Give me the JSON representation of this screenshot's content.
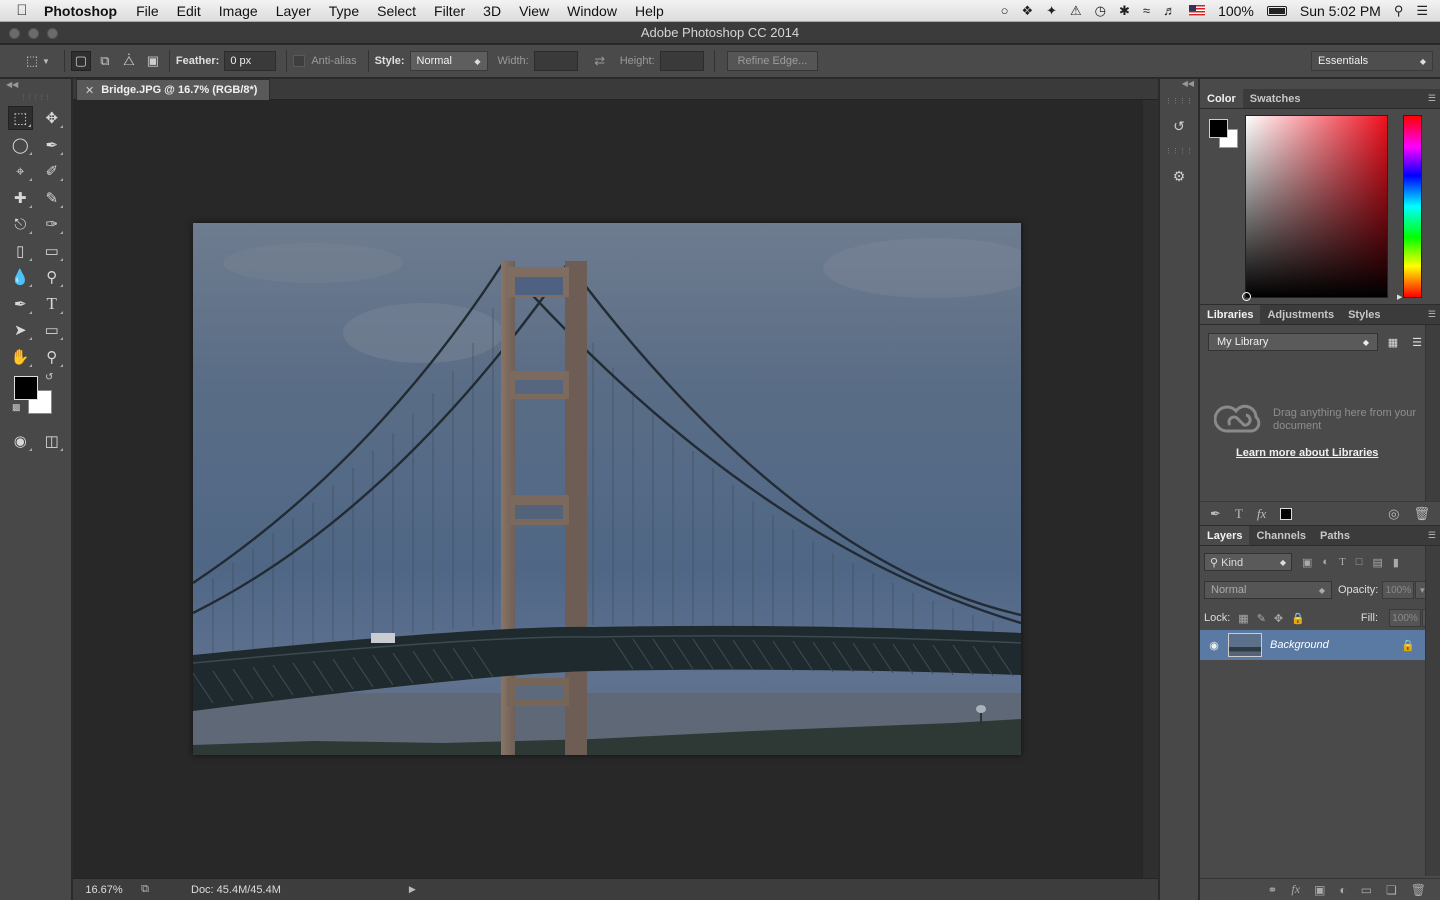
{
  "menubar": {
    "app_name": "Photoshop",
    "items": [
      "File",
      "Edit",
      "Image",
      "Layer",
      "Type",
      "Select",
      "Filter",
      "3D",
      "View",
      "Window",
      "Help"
    ],
    "battery": "100%",
    "clock": "Sun 5:02 PM"
  },
  "window": {
    "title": "Adobe Photoshop CC 2014"
  },
  "options": {
    "feather_label": "Feather:",
    "feather_value": "0 px",
    "antialias_label": "Anti-alias",
    "style_label": "Style:",
    "style_value": "Normal",
    "width_label": "Width:",
    "height_label": "Height:",
    "refine_edge": "Refine Edge...",
    "workspace": "Essentials"
  },
  "document": {
    "tab_title": "Bridge.JPG @ 16.7% (RGB/8*)",
    "zoom": "16.67%",
    "doc_info": "Doc: 45.4M/45.4M"
  },
  "color_panel": {
    "tabs": [
      "Color",
      "Swatches"
    ],
    "foreground": "#000000",
    "background": "#ffffff",
    "hue_color": "#f0101f"
  },
  "libraries_panel": {
    "tabs": [
      "Libraries",
      "Adjustments",
      "Styles"
    ],
    "library": "My Library",
    "empty_text": "Drag anything here from your document",
    "learn_link": "Learn more about Libraries"
  },
  "layers_panel": {
    "tabs": [
      "Layers",
      "Channels",
      "Paths"
    ],
    "kind": "Kind",
    "blend_mode": "Normal",
    "opacity_label": "Opacity:",
    "opacity_value": "100%",
    "lock_label": "Lock:",
    "fill_label": "Fill:",
    "fill_value": "100%",
    "layers": [
      {
        "name": "Background",
        "locked": true,
        "visible": true,
        "selected": true
      }
    ],
    "selected_color": "#5a7aa3"
  }
}
